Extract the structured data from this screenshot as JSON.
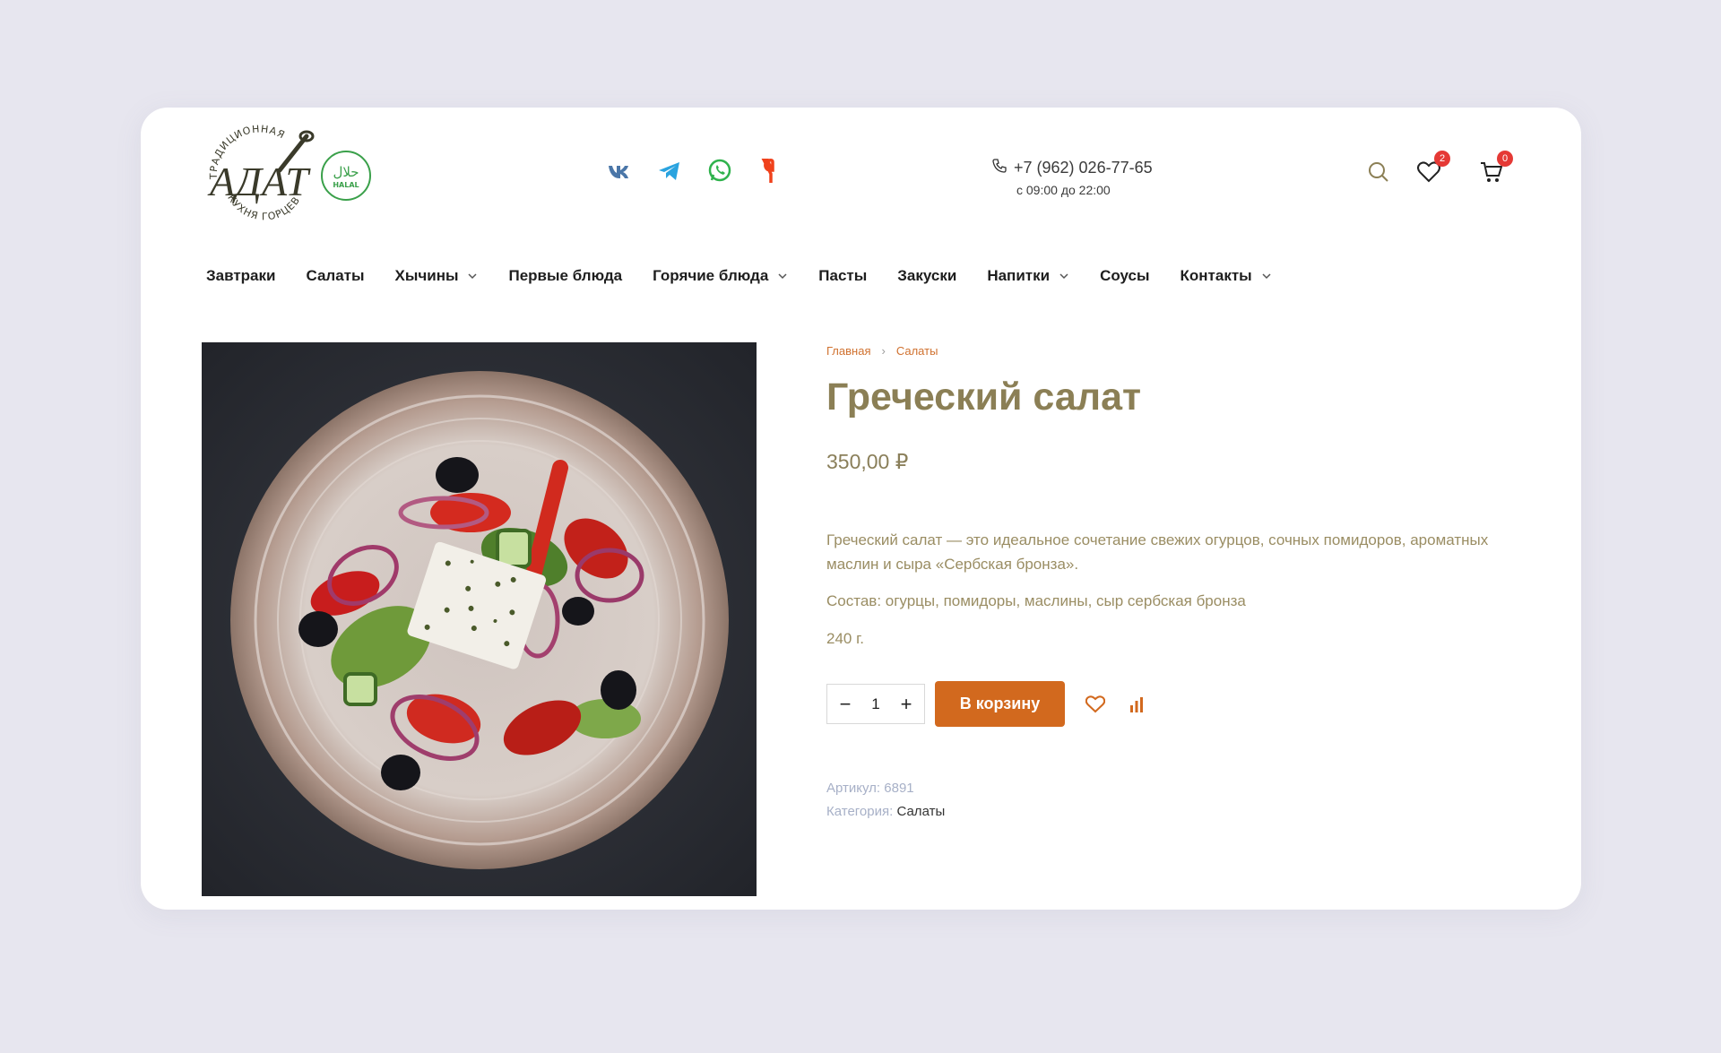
{
  "brand": {
    "logo_name": "АДАТ",
    "logo_top": "ТРАДИЦИОННАЯ",
    "logo_bottom": "КУХНЯ ГОРЦЕВ",
    "halal_arabic": "حلال",
    "halal_latin": "HALAL"
  },
  "social": [
    {
      "icon": "vk-icon",
      "color": "#4a76a8"
    },
    {
      "icon": "telegram-icon",
      "color": "#2aa3df"
    },
    {
      "icon": "whatsapp-icon",
      "color": "#2fb24c"
    },
    {
      "icon": "yandex-icon",
      "color": "#f0421c"
    }
  ],
  "contact": {
    "phone": "+7 (962) 026-77-65",
    "hours": "с 09:00 до 22:00"
  },
  "header_actions": {
    "wishlist_count": "2",
    "cart_count": "0"
  },
  "menu": [
    {
      "label": "Завтраки",
      "dropdown": false
    },
    {
      "label": "Салаты",
      "dropdown": false
    },
    {
      "label": "Хычины",
      "dropdown": true
    },
    {
      "label": "Первые блюда",
      "dropdown": false
    },
    {
      "label": "Горячие блюда",
      "dropdown": true
    },
    {
      "label": "Пасты",
      "dropdown": false
    },
    {
      "label": "Закуски",
      "dropdown": false
    },
    {
      "label": "Напитки",
      "dropdown": true
    },
    {
      "label": "Соусы",
      "dropdown": false
    },
    {
      "label": "Контакты",
      "dropdown": true
    }
  ],
  "breadcrumb": {
    "home": "Главная",
    "current": "Салаты"
  },
  "product": {
    "title": "Греческий салат",
    "price": "350,00 ₽",
    "description": "Греческий салат — это идеальное сочетание свежих огурцов, сочных помидоров, ароматных маслин и сыра «Сербская бронза».",
    "composition": "Состав: огурцы, помидоры, маслины, сыр сербская бронза",
    "weight": "240 г.",
    "quantity": "1",
    "add_to_cart_label": "В корзину",
    "sku_label": "Артикул:",
    "sku_value": "6891",
    "category_label": "Категория:",
    "category_value": "Салаты"
  },
  "colors": {
    "accent": "#d2691e",
    "title": "#8b7f55",
    "background": "#e7e6ef"
  }
}
